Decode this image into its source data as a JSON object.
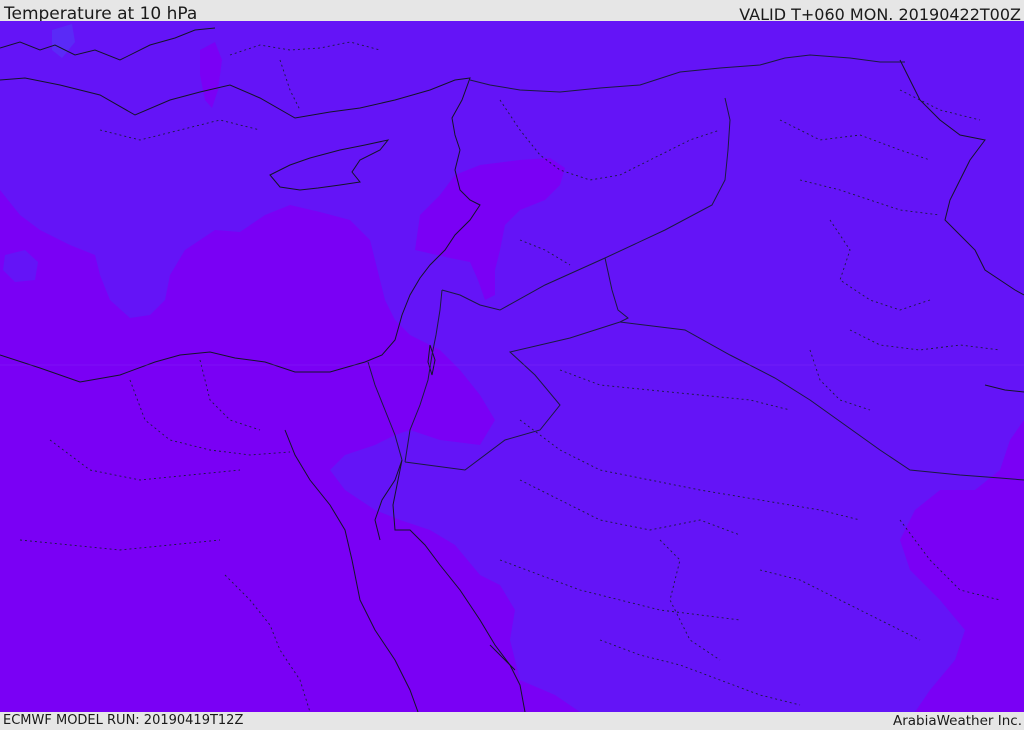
{
  "header": {
    "title": "Temperature at 10 hPa",
    "valid_time": "VALID T+060 MON. 20190422T00Z"
  },
  "footer": {
    "model_run": "ECMWF MODEL RUN: 20190419T12Z",
    "credit": "ArabiaWeather Inc."
  },
  "map": {
    "region": "Eastern Mediterranean and Middle East",
    "colors": {
      "warmer_field": "#7a00f5",
      "cooler_field": "#6414f7",
      "coastline": "#141428",
      "borders": "#1a1a40"
    }
  }
}
